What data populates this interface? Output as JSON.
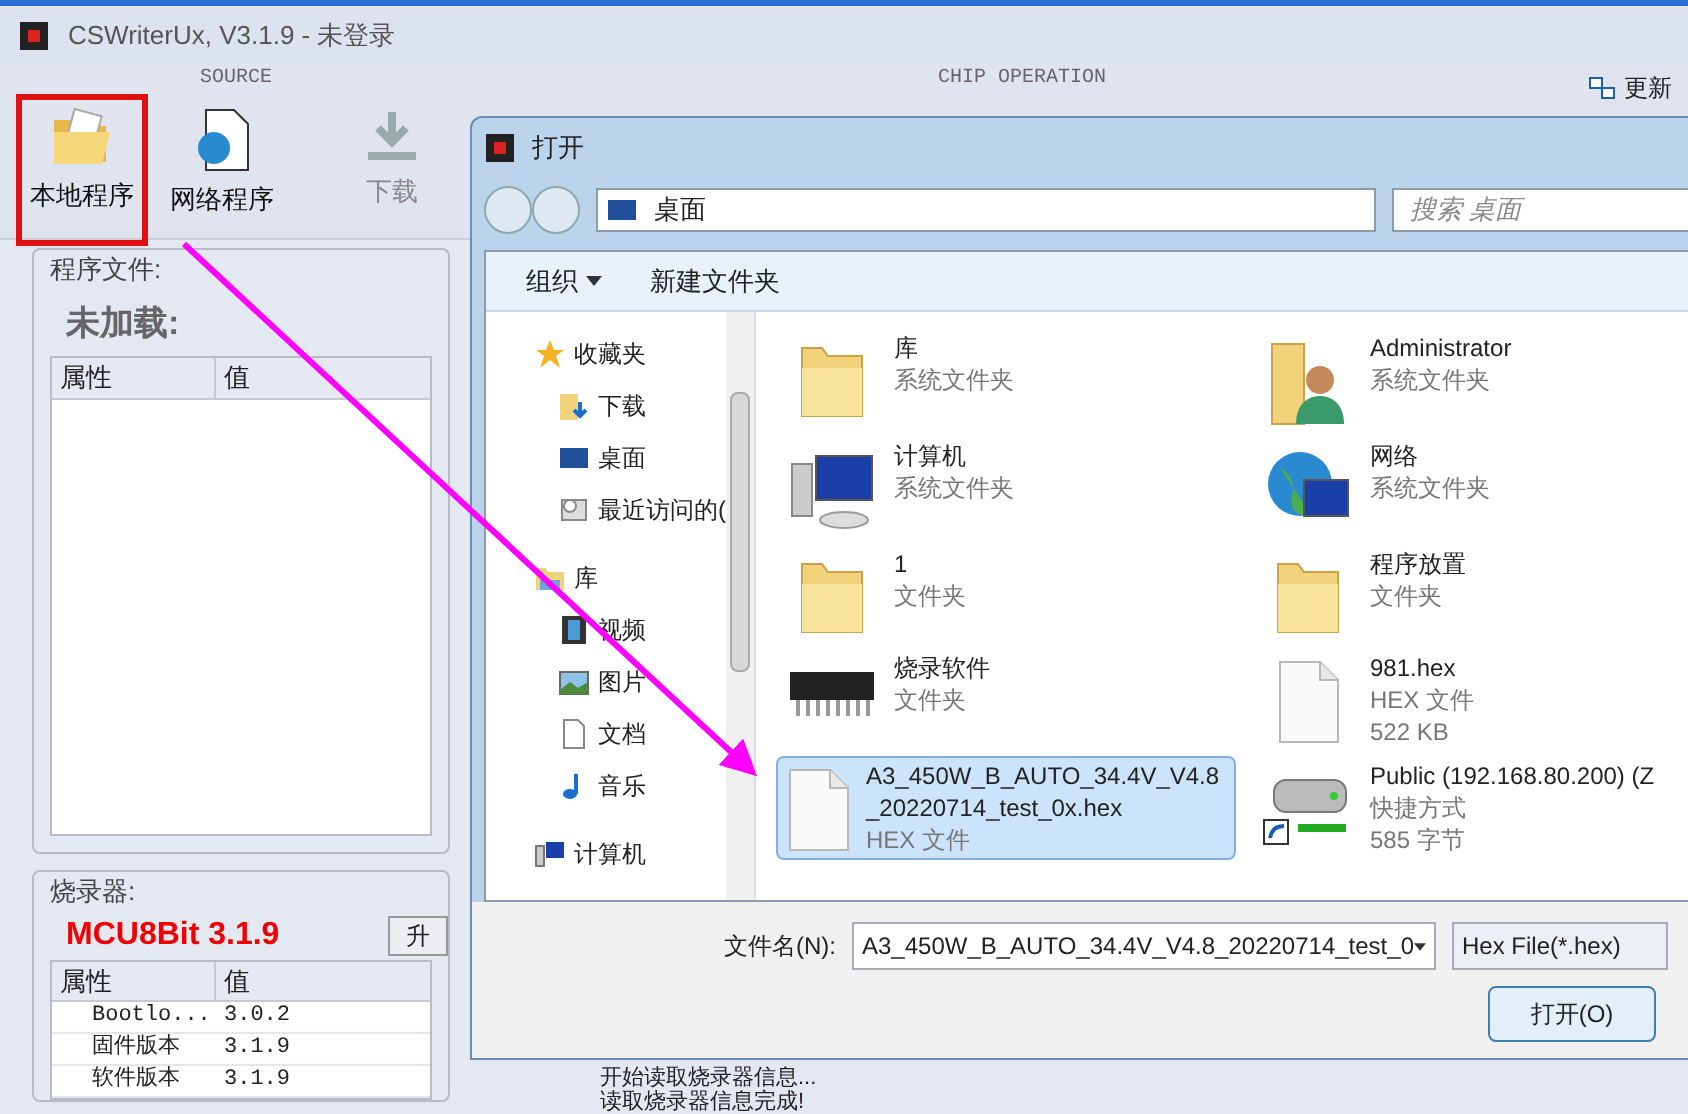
{
  "window": {
    "title": "CSWriterUx, V3.1.9 - 未登录"
  },
  "toolbar": {
    "groups": [
      "SOURCE",
      "CHIP OPERATION"
    ],
    "buttons": [
      {
        "label": "本地程序",
        "kind": "local",
        "highlighted": true,
        "disabled": false
      },
      {
        "label": "网络程序",
        "kind": "network",
        "highlighted": false,
        "disabled": false
      },
      {
        "label": "下载",
        "kind": "download",
        "highlighted": false,
        "disabled": true
      }
    ],
    "update": "更新"
  },
  "program_file": {
    "title": "程序文件:",
    "status": "未加载:",
    "columns": [
      "属性",
      "值"
    ]
  },
  "programmer": {
    "title": "烧录器:",
    "name": "MCU8Bit 3.1.9",
    "button": "升",
    "columns": [
      "属性",
      "值"
    ],
    "rows": [
      [
        "Bootlo...",
        "3.0.2"
      ],
      [
        "固件版本",
        "3.1.9"
      ],
      [
        "软件版本",
        "3.1.9"
      ]
    ]
  },
  "log": [
    "开始读取烧录器信息...",
    "读取烧录器信息完成!"
  ],
  "dialog": {
    "title": "打开",
    "path": "桌面",
    "search": {
      "placeholder": "搜索 桌面"
    },
    "toolbar": [
      {
        "label": "组织",
        "kind": "menu"
      },
      {
        "label": "新建文件夹",
        "kind": "plain"
      }
    ],
    "nav": [
      {
        "label": "收藏夹",
        "kind": "star",
        "children": [
          {
            "label": "下载",
            "kind": "downloads"
          },
          {
            "label": "桌面",
            "kind": "desktop"
          },
          {
            "label": "最近访问的(",
            "kind": "recent"
          }
        ]
      },
      {
        "label": "库",
        "kind": "library",
        "children": [
          {
            "label": "视频",
            "kind": "video"
          },
          {
            "label": "图片",
            "kind": "picture"
          },
          {
            "label": "文档",
            "kind": "document"
          },
          {
            "label": "音乐",
            "kind": "music"
          }
        ]
      },
      {
        "label": "计算机",
        "kind": "computer"
      }
    ],
    "files": [
      {
        "name": "库",
        "type": "系统文件夹",
        "kind": "library",
        "selected": false
      },
      {
        "name": "Administrator",
        "type": "系统文件夹",
        "kind": "user",
        "selected": false
      },
      {
        "name": "计算机",
        "type": "系统文件夹",
        "kind": "computer",
        "selected": false
      },
      {
        "name": "网络",
        "type": "系统文件夹",
        "kind": "network",
        "selected": false
      },
      {
        "name": "1",
        "type": "文件夹",
        "kind": "folder",
        "selected": false
      },
      {
        "name": "程序放置",
        "type": "文件夹",
        "kind": "folder",
        "selected": false
      },
      {
        "name": "烧录软件",
        "type": "文件夹",
        "kind": "chip",
        "selected": false
      },
      {
        "name": "981.hex",
        "type": "HEX 文件",
        "size": "522 KB",
        "kind": "file",
        "selected": false
      },
      {
        "name": "A3_450W_B_AUTO_34.4V_V4.8_20220714_test_0x.hex",
        "type": "HEX 文件",
        "kind": "file",
        "selected": true
      },
      {
        "name": "Public (192.168.80.200) (Z",
        "type": "快捷方式",
        "size": "585 字节",
        "kind": "drive",
        "selected": false
      }
    ],
    "filename_label": "文件名(N):",
    "filename": "A3_450W_B_AUTO_34.4V_V4.8_20220714_test_0",
    "filter": "Hex File(*.hex)",
    "open_button": "打开(O)"
  }
}
